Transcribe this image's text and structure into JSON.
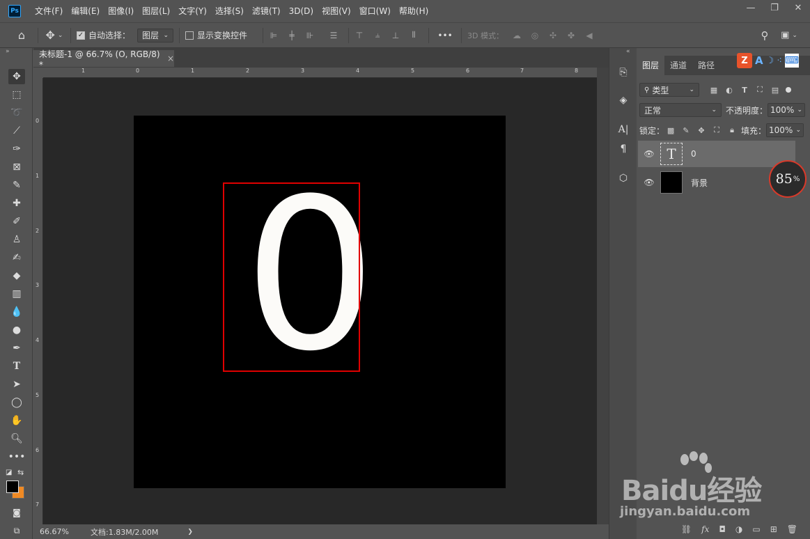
{
  "app": {
    "logo": "Ps"
  },
  "menu": [
    "文件(F)",
    "编辑(E)",
    "图像(I)",
    "图层(L)",
    "文字(Y)",
    "选择(S)",
    "滤镜(T)",
    "3D(D)",
    "视图(V)",
    "窗口(W)",
    "帮助(H)"
  ],
  "options": {
    "auto_select_label": "自动选择：",
    "auto_select_target": "图层",
    "show_transform_label": "显示变换控件",
    "more_label": "•••",
    "mode_3d_label": "3D 模式："
  },
  "document": {
    "tab_title": "未标题-1 @ 66.7% (O, RGB/8) *",
    "tab_close": "×",
    "canvas_glyph": "0",
    "canvas_bg": "#000000",
    "glyph_color": "#fcfbf8",
    "highlight_color": "#e00000"
  },
  "rulers": {
    "top": [
      "1",
      "0",
      "1",
      "2",
      "3",
      "4",
      "5",
      "6",
      "7",
      "8"
    ],
    "left": [
      "0",
      "1",
      "2",
      "3",
      "4",
      "5",
      "6",
      "7"
    ]
  },
  "status": {
    "zoom": "66.67%",
    "doc_info": "文档:1.83M/2.00M",
    "arrow": "❯"
  },
  "panel": {
    "tabs": [
      "图层",
      "通道",
      "路径"
    ],
    "filter_label": "类型",
    "blend_mode": "正常",
    "opacity_label": "不透明度：",
    "opacity_value": "100%",
    "lock_label": "锁定：",
    "fill_label": "填充：",
    "fill_value": "100%",
    "layers": [
      {
        "name": "0",
        "type": "text",
        "thumb": "T",
        "selected": true
      },
      {
        "name": "背景",
        "type": "background",
        "thumb": "",
        "selected": false
      }
    ]
  },
  "badge": {
    "value": "85",
    "unit": "%"
  },
  "watermark": {
    "main": "Baidu经验",
    "sub": "jingyan.baidu.com"
  }
}
